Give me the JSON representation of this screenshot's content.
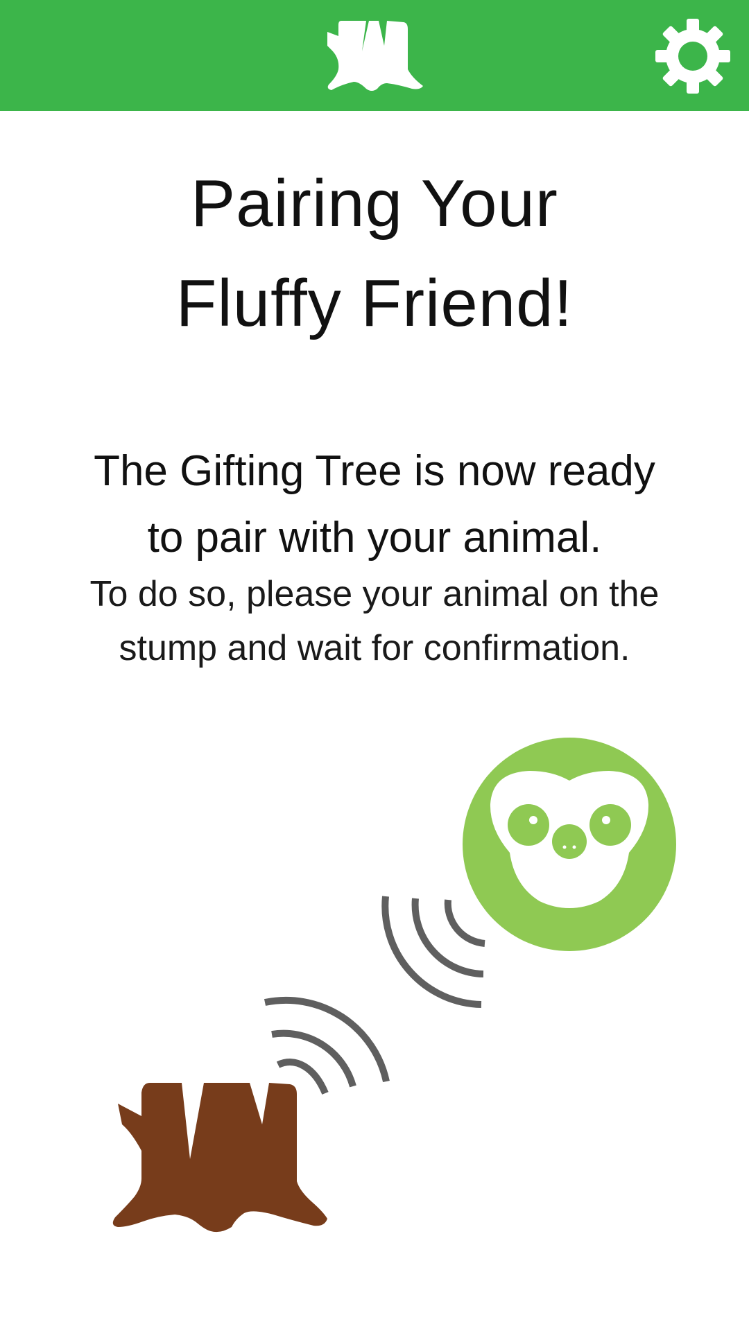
{
  "header": {
    "logo_icon": "tree-stump-icon",
    "settings_icon": "gear-icon",
    "background_color": "#3cb54a"
  },
  "title": {
    "line1": "Pairing Your",
    "line2": "Fluffy Friend!"
  },
  "lead": {
    "line1": "The Gifting Tree is now ready",
    "line2": "to pair with your animal."
  },
  "instructions": {
    "line1": "To do so, please your animal on the",
    "line2": "stump and wait for confirmation."
  },
  "illustration": {
    "animal_icon": "sloth-face-icon",
    "animal_color": "#8fc953",
    "stump_icon": "tree-stump-icon",
    "stump_color": "#773c1b",
    "signal_icon": "wireless-signal-icon",
    "signal_color": "#5f5f5f"
  }
}
